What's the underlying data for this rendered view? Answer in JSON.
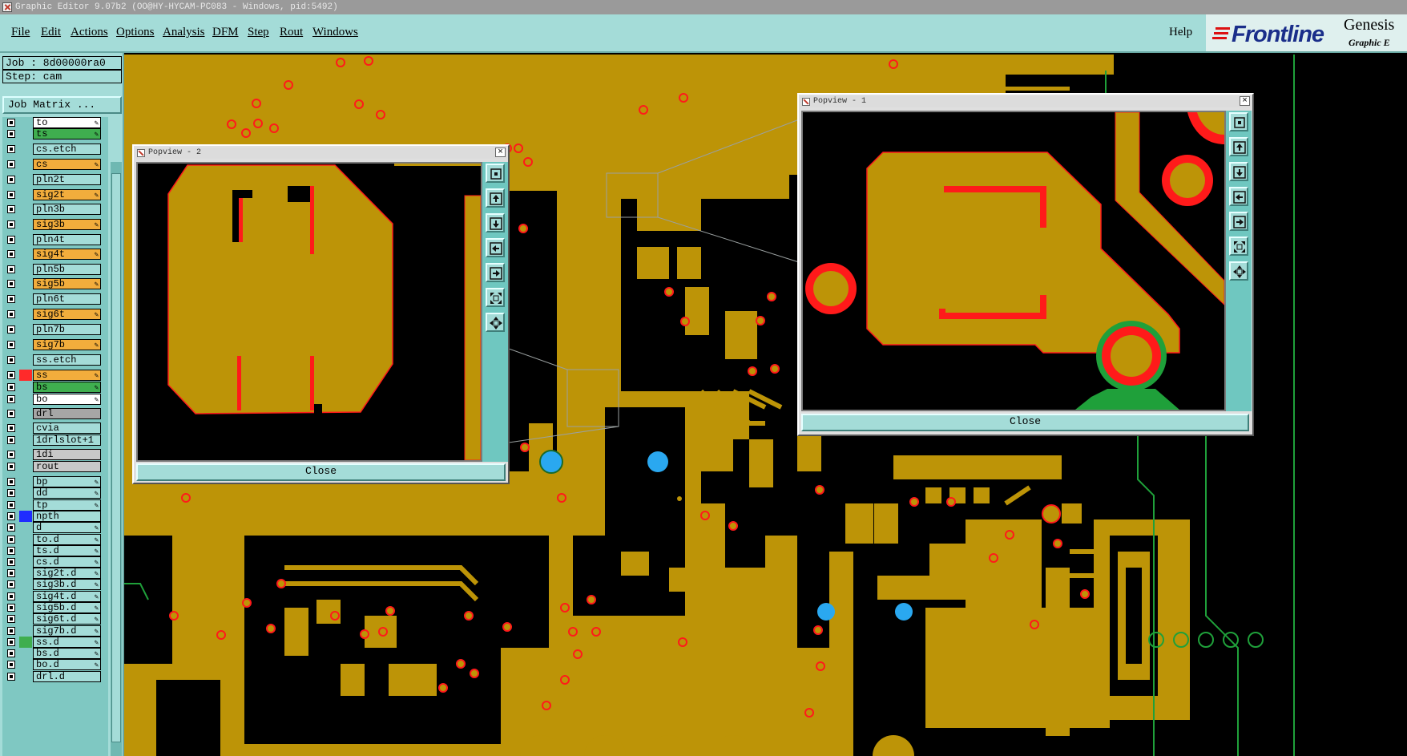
{
  "window": {
    "title": "Graphic Editor 9.07b2 (OO@HY-HYCAM-PC083 - Windows, pid:5492)"
  },
  "menu": {
    "items": [
      "File",
      "Edit",
      "Actions",
      "Options",
      "Analysis",
      "DFM",
      "Step",
      "Rout",
      "Windows"
    ],
    "help": "Help"
  },
  "brand": {
    "logo": "Frontline",
    "product": "Genesis",
    "subtitle": "Graphic E"
  },
  "job": {
    "job_line": "Job : 8d00000ra0",
    "step_line": "Step: cam",
    "matrix_button": "Job Matrix ..."
  },
  "layers": [
    {
      "name": "to",
      "color": "#ffffff",
      "edit": true
    },
    {
      "name": "ts",
      "color": "#3fae4f",
      "edit": true
    },
    {
      "name": "cs.etch",
      "color": "#a4dcd8",
      "edit": false
    },
    {
      "name": "cs",
      "color": "#f2ad3c",
      "edit": true
    },
    {
      "name": "pln2t",
      "color": "#a4dcd8",
      "edit": false
    },
    {
      "name": "sig2t",
      "color": "#f2ad3c",
      "edit": true
    },
    {
      "name": "pln3b",
      "color": "#a4dcd8",
      "edit": false
    },
    {
      "name": "sig3b",
      "color": "#f2ad3c",
      "edit": true
    },
    {
      "name": "pln4t",
      "color": "#a4dcd8",
      "edit": false
    },
    {
      "name": "sig4t",
      "color": "#f2ad3c",
      "edit": true
    },
    {
      "name": "pln5b",
      "color": "#a4dcd8",
      "edit": false
    },
    {
      "name": "sig5b",
      "color": "#f2ad3c",
      "edit": true
    },
    {
      "name": "pln6t",
      "color": "#a4dcd8",
      "edit": false
    },
    {
      "name": "sig6t",
      "color": "#f2ad3c",
      "edit": true
    },
    {
      "name": "pln7b",
      "color": "#a4dcd8",
      "edit": false
    },
    {
      "name": "sig7b",
      "color": "#f2ad3c",
      "edit": true
    },
    {
      "name": "ss.etch",
      "color": "#a4dcd8",
      "edit": false
    },
    {
      "name": "ss",
      "color": "#f2ad3c",
      "edit": true
    },
    {
      "name": "bs",
      "color": "#3fae4f",
      "edit": true
    },
    {
      "name": "bo",
      "color": "#ffffff",
      "edit": true
    },
    {
      "name": "drl",
      "color": "#a6a6a6",
      "edit": false
    },
    {
      "name": "cvia",
      "color": "#a4dcd8",
      "edit": false
    },
    {
      "name": "1drlslot+1",
      "color": "#a4dcd8",
      "edit": false
    },
    {
      "name": "1di",
      "color": "#c8c8c8",
      "edit": false
    },
    {
      "name": "rout",
      "color": "#c8c8c8",
      "edit": false
    },
    {
      "name": "bp",
      "color": "#a4dcd8",
      "edit": true
    },
    {
      "name": "dd",
      "color": "#a4dcd8",
      "edit": true
    },
    {
      "name": "tp",
      "color": "#a4dcd8",
      "edit": true
    },
    {
      "name": "npth",
      "color": "#a4dcd8",
      "edit": false
    },
    {
      "name": "d",
      "color": "#a4dcd8",
      "edit": true
    },
    {
      "name": "to.d",
      "color": "#a4dcd8",
      "edit": true
    },
    {
      "name": "ts.d",
      "color": "#a4dcd8",
      "edit": true
    },
    {
      "name": "cs.d",
      "color": "#a4dcd8",
      "edit": true
    },
    {
      "name": "sig2t.d",
      "color": "#a4dcd8",
      "edit": true
    },
    {
      "name": "sig3b.d",
      "color": "#a4dcd8",
      "edit": true
    },
    {
      "name": "sig4t.d",
      "color": "#a4dcd8",
      "edit": true
    },
    {
      "name": "sig5b.d",
      "color": "#a4dcd8",
      "edit": true
    },
    {
      "name": "sig6t.d",
      "color": "#a4dcd8",
      "edit": true
    },
    {
      "name": "sig7b.d",
      "color": "#a4dcd8",
      "edit": true
    },
    {
      "name": "ss.d",
      "color": "#a4dcd8",
      "edit": true
    },
    {
      "name": "bs.d",
      "color": "#a4dcd8",
      "edit": true
    },
    {
      "name": "bo.d",
      "color": "#a4dcd8",
      "edit": true
    },
    {
      "name": "drl.d",
      "color": "#a4dcd8",
      "edit": false
    }
  ],
  "layer_swatches": {
    "ss": "#ff2a2a",
    "npth": "#1f2cff",
    "ss.d": "#3fae4f"
  },
  "popview1": {
    "title": "Popview - 1",
    "close_label": "Close"
  },
  "popview2": {
    "title": "Popview - 2",
    "close_label": "Close"
  },
  "colors": {
    "copper": "#bd9407",
    "pad_edge": "#ff1a1a",
    "drill": "#2aa8f0",
    "board_bg": "#000000",
    "outline": "#1fa03a",
    "panel": "#a4dcd8"
  },
  "icons": [
    "zoom-fit-icon",
    "zoom-in-icon",
    "zoom-out-icon",
    "pan-left-icon",
    "pan-right-icon",
    "zoom-extents-icon",
    "fit-all-icon"
  ]
}
